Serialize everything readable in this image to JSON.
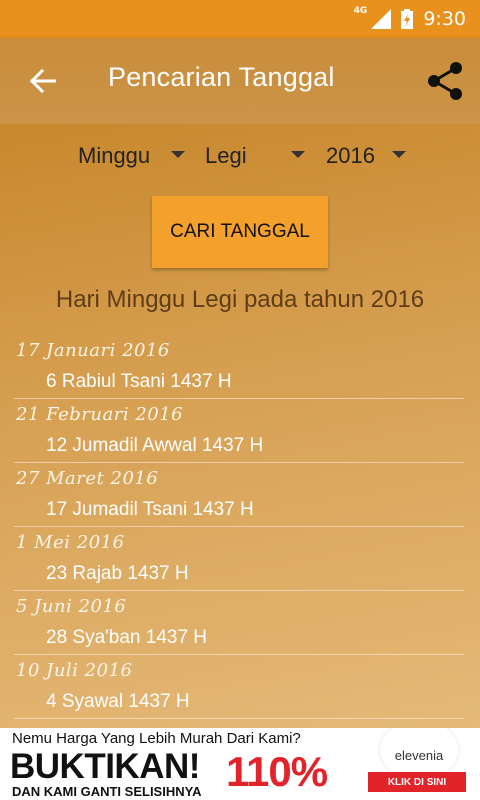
{
  "status_bar": {
    "network": "4G",
    "time": "9:30"
  },
  "app_bar": {
    "title": "Pencarian Tanggal",
    "back_icon": "arrow-left-icon",
    "share_icon": "share-icon"
  },
  "selectors": {
    "day": "Minggu",
    "pasaran": "Legi",
    "year": "2016"
  },
  "search_button": {
    "label": "CARI TANGGAL"
  },
  "result_title": "Hari Minggu Legi pada tahun 2016",
  "results": [
    {
      "date": "17 Januari 2016",
      "hijri": "6 Rabiul Tsani 1437 H"
    },
    {
      "date": "21 Februari 2016",
      "hijri": "12 Jumadil Awwal 1437 H"
    },
    {
      "date": "27 Maret 2016",
      "hijri": "17 Jumadil Tsani 1437 H"
    },
    {
      "date": "1 Mei 2016",
      "hijri": "23 Rajab 1437 H"
    },
    {
      "date": "5 Juni 2016",
      "hijri": "28 Sya'ban 1437 H"
    },
    {
      "date": "10 Juli 2016",
      "hijri": "4 Syawal 1437 H"
    }
  ],
  "ad": {
    "line1": "Nemu Harga Yang Lebih Murah Dari Kami?",
    "headline": "BUKTIKAN!",
    "percent": "110%",
    "line2": "DAN KAMI GANTI SELISIHNYA",
    "brand": "elevenia",
    "cta": "KLIK DI SINI"
  },
  "colors": {
    "accent": "#f4a02d",
    "status_bar": "#e8911d",
    "ad_red": "#e1232a"
  }
}
